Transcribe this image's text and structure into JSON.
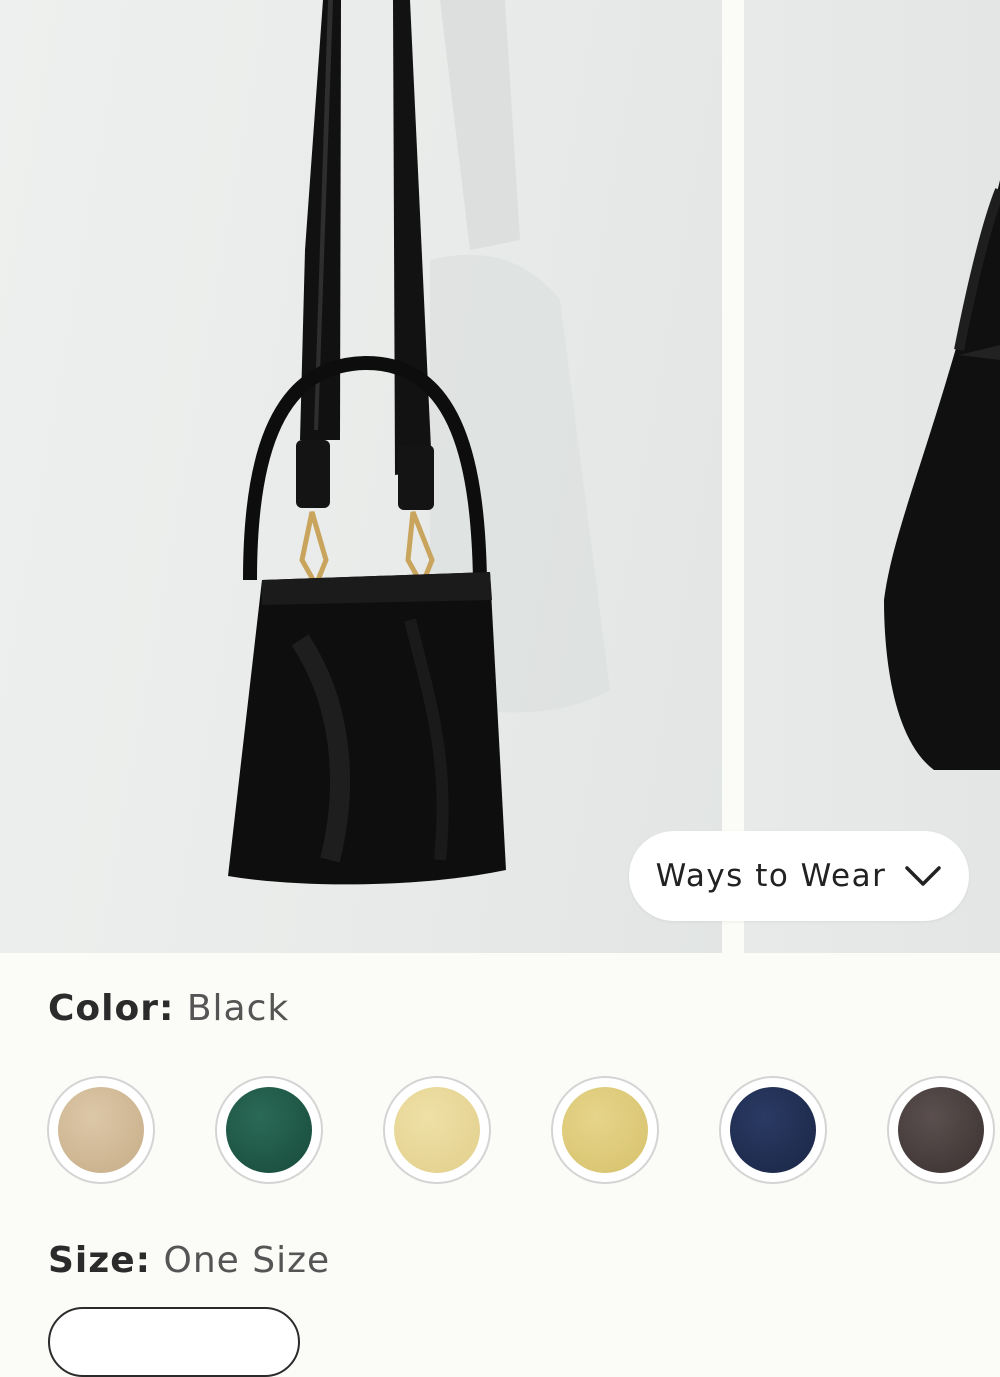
{
  "gallery": {
    "ways_to_wear_label": "Ways to Wear",
    "main_image_alt": "Black bucket bag hanging on wall",
    "next_image_alt": "Black bucket bag side view"
  },
  "options": {
    "color_label": "Color:",
    "color_value": "Black",
    "size_label": "Size:",
    "size_value": "One Size"
  },
  "swatches": [
    {
      "name": "Taupe",
      "color": "#cdb593"
    },
    {
      "name": "Green",
      "color": "#1f5a48"
    },
    {
      "name": "Light Yellow",
      "color": "#e8d798"
    },
    {
      "name": "Yellow",
      "color": "#ddc97a"
    },
    {
      "name": "Navy",
      "color": "#1f2d52"
    },
    {
      "name": "Brown",
      "color": "#4a3f3e"
    }
  ]
}
